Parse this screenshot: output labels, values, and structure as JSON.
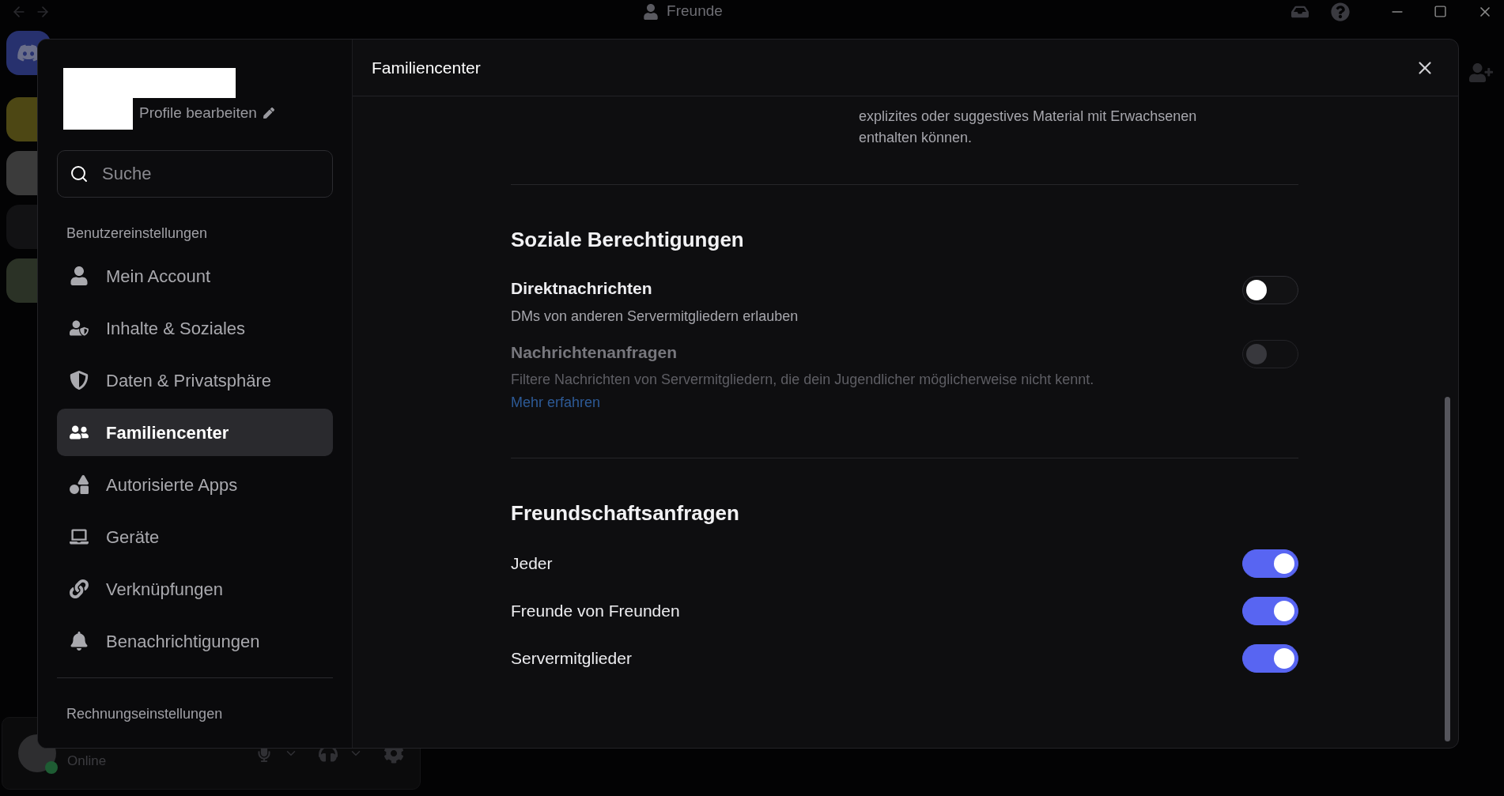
{
  "title_bar": {
    "title": "Freunde"
  },
  "user_panel": {
    "status": "Online"
  },
  "modal": {
    "title": "Familiencenter"
  },
  "sidebar": {
    "edit_profile": "Profile bearbeiten",
    "search": {
      "placeholder": "Suche"
    },
    "sections": [
      {
        "heading": "Benutzereinstellungen",
        "items": [
          {
            "label": "Mein Account",
            "selected": false
          },
          {
            "label": "Inhalte & Soziales",
            "selected": false
          },
          {
            "label": "Daten & Privatsphäre",
            "selected": false
          },
          {
            "label": "Familiencenter",
            "selected": true
          },
          {
            "label": "Autorisierte Apps",
            "selected": false
          },
          {
            "label": "Geräte",
            "selected": false
          },
          {
            "label": "Verknüpfungen",
            "selected": false
          },
          {
            "label": "Benachrichtigungen",
            "selected": false
          }
        ]
      },
      {
        "heading": "Rechnungseinstellungen"
      }
    ]
  },
  "content": {
    "intro_text": "explizites oder suggestives Material mit Erwachsenen enthalten können.",
    "sections": [
      {
        "heading": "Soziale Berechtigungen",
        "settings": [
          {
            "label": "Direktnachrichten",
            "description": "DMs von anderen Servermitgliedern erlauben",
            "on": false,
            "disabled": false
          },
          {
            "label": "Nachrichtenanfragen",
            "description": "Filtere Nachrichten von Servermitgliedern, die dein Jugendlicher möglicherweise nicht kennt.",
            "link": "Mehr erfahren",
            "on": false,
            "disabled": true
          }
        ]
      },
      {
        "heading": "Freundschaftsanfragen",
        "settings": [
          {
            "label": "Jeder",
            "on": true,
            "disabled": false
          },
          {
            "label": "Freunde von Freunden",
            "on": true,
            "disabled": false
          },
          {
            "label": "Servermitglieder",
            "on": true,
            "disabled": false
          }
        ]
      }
    ]
  }
}
